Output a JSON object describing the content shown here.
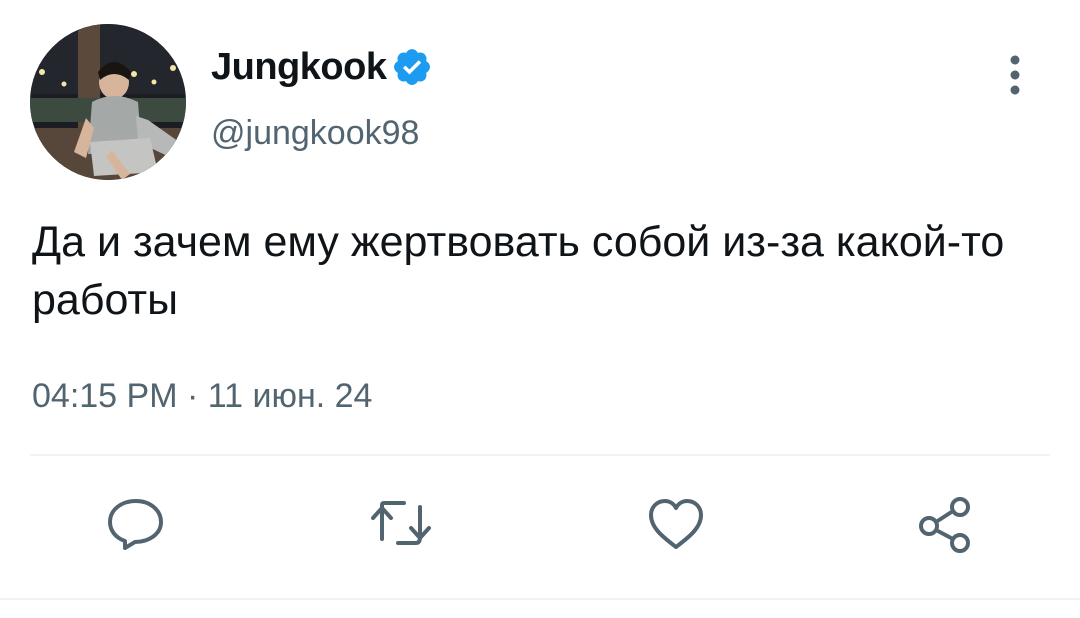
{
  "author": {
    "display_name": "Jungkook",
    "handle": "@jungkook98",
    "verified": true,
    "avatar_icon": "profile-photo"
  },
  "tweet": {
    "text": "Да и зачем ему жертвовать собой из-за какой-то работы",
    "timestamp": "04:15 PM · 11 июн. 24"
  },
  "actions": [
    {
      "icon": "reply-icon"
    },
    {
      "icon": "retweet-icon"
    },
    {
      "icon": "like-icon"
    },
    {
      "icon": "share-icon"
    }
  ],
  "colors": {
    "text_primary": "#0f1419",
    "text_secondary": "#536471",
    "verified_blue": "#1d9bf0",
    "icon_gray": "#536471"
  }
}
